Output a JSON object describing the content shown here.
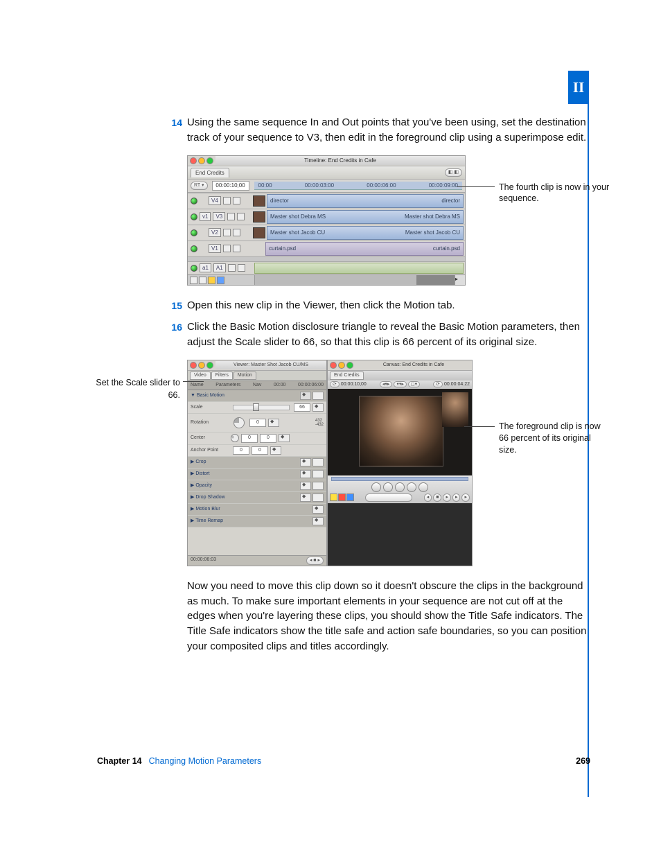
{
  "part_tab": "II",
  "steps": [
    {
      "num": "14",
      "text": "Using the same sequence In and Out points that you've been using, set the destination track of your sequence to V3, then edit in the foreground clip using a superimpose edit."
    },
    {
      "num": "15",
      "text": "Open this new clip in the Viewer, then click the Motion tab."
    },
    {
      "num": "16",
      "text": "Click the Basic Motion disclosure triangle to reveal the Basic Motion parameters, then adjust the Scale slider to 66, so that this clip is 66 percent of its original size."
    }
  ],
  "timeline": {
    "title": "Timeline: End Credits in Cafe",
    "tab": "End Credits",
    "rt": "RT ▾",
    "tc": "00:00:10;00",
    "ruler": [
      "00:00",
      "00:00:03:00",
      "00:00:06:00",
      "00:00:09:00"
    ],
    "tracks": [
      {
        "id": "V4",
        "clip": "director",
        "has_v1": false
      },
      {
        "id": "V3",
        "clip": "Master shot Debra MS",
        "has_v1": true
      },
      {
        "id": "V2",
        "clip": "Master shot Jacob CU",
        "has_v1": false
      },
      {
        "id": "V1",
        "clip": "curtain.psd",
        "has_v1": false
      }
    ],
    "audio": {
      "id": "A1"
    }
  },
  "callout1": "The fourth clip is now in your sequence.",
  "callout_left": "Set the Scale slider to 66.",
  "callout2": "The foreground clip is now 66 percent of its original size.",
  "viewer": {
    "title": "Viewer: Master Shot Jacob CU/MS",
    "tabs": [
      "Video",
      "Filters",
      "Motion"
    ],
    "head": {
      "name": "Name",
      "params": "Parameters",
      "nav": "Nav",
      "t1": "00:00",
      "t2": "00:00:06:00"
    },
    "basic": "▼ Basic Motion",
    "rows": {
      "scale": "Scale",
      "rotation": "Rotation",
      "center": "Center",
      "anchor": "Anchor Point"
    },
    "scale_val": "66",
    "rot_val": "0",
    "center_val": "0",
    "anchor_val": "0",
    "rot_marks": {
      "top": "432",
      "bot": "-432"
    },
    "sections": [
      "▶ Crop",
      "▶ Distort",
      "▶ Opacity",
      "▶ Drop Shadow",
      "▶ Motion Blur",
      "▶ Time Remap"
    ],
    "foot_tc": "00:00:06:03"
  },
  "canvas": {
    "title": "Canvas: End Credits in Cafe",
    "tab": "End Credits",
    "tc_left": "00:00:10;00",
    "tc_right": "00:00:04:22"
  },
  "body_para": "Now you need to move this clip down so it doesn't obscure the clips in the background as much. To make sure important elements in your sequence are not cut off at the edges when you're layering these clips, you should show the Title Safe indicators. The Title Safe indicators show the title safe and action safe boundaries, so you can position your composited clips and titles accordingly.",
  "footer": {
    "chapter": "Chapter 14",
    "title": "Changing Motion Parameters",
    "page": "269"
  }
}
